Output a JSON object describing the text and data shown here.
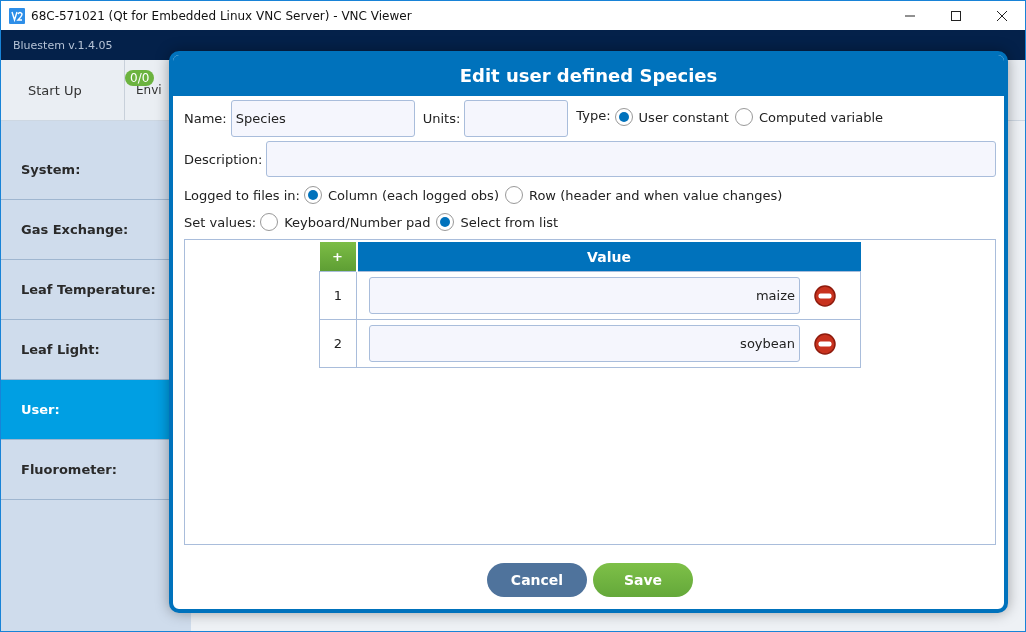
{
  "window": {
    "title": "68C-571021 (Qt for Embedded Linux VNC Server) - VNC Viewer"
  },
  "app": {
    "version": "Bluestem v.1.4.05"
  },
  "steps": [
    {
      "label": "Start Up",
      "selected": false
    },
    {
      "label": "Envi",
      "badge": "0/0",
      "selected": false
    }
  ],
  "sidebar": {
    "items": [
      {
        "label": "System:",
        "selected": false
      },
      {
        "label": "Gas Exchange:",
        "selected": false
      },
      {
        "label": "Leaf Temperature:",
        "selected": false
      },
      {
        "label": "Leaf Light:",
        "selected": false
      },
      {
        "label": "User:",
        "selected": true
      },
      {
        "label": "Fluorometer:",
        "selected": false
      }
    ]
  },
  "dialog": {
    "title": "Edit user defined Species",
    "name": {
      "label": "Name:",
      "value": "Species"
    },
    "units": {
      "label": "Units:"
    },
    "type": {
      "label": "Type:",
      "options": [
        {
          "label": "User constant",
          "selected": true
        },
        {
          "label": "Computed variable",
          "selected": false
        }
      ]
    },
    "description": {
      "label": "Description:"
    },
    "logged": {
      "label": "Logged to files in:",
      "options": [
        {
          "label": "Column (each logged obs)",
          "selected": true
        },
        {
          "label": "Row (header and when value changes)",
          "selected": false
        }
      ]
    },
    "set_values": {
      "label": "Set values:",
      "options": [
        {
          "label": "Keyboard/Number pad",
          "selected": false
        },
        {
          "label": "Select from list",
          "selected": true
        }
      ]
    },
    "table": {
      "add": "+",
      "columns": [
        "Value"
      ],
      "rows": [
        {
          "index": "1",
          "value": "maize"
        },
        {
          "index": "2",
          "value": "soybean"
        }
      ]
    },
    "buttons": [
      {
        "label": "Cancel",
        "kind": "cancel"
      },
      {
        "label": "Save",
        "kind": "save"
      }
    ]
  }
}
